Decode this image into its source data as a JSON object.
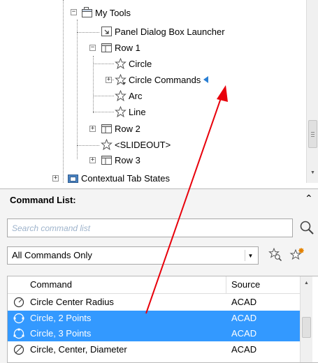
{
  "tree": {
    "nodes": [
      {
        "label": "My Tools"
      },
      {
        "label": "Panel Dialog Box Launcher"
      },
      {
        "label": "Row 1"
      },
      {
        "label": "Circle"
      },
      {
        "label": "Circle Commands"
      },
      {
        "label": "Arc"
      },
      {
        "label": "Line"
      },
      {
        "label": "Row 2"
      },
      {
        "label": "<SLIDEOUT>"
      },
      {
        "label": "Row 3"
      },
      {
        "label": "Contextual Tab States"
      }
    ],
    "expand_collapsed": "+",
    "expand_open": "−"
  },
  "command_panel": {
    "title": "Command List:",
    "collapse_glyph": "⌃",
    "search": {
      "placeholder": "Search command list",
      "value": ""
    },
    "filter": {
      "selected": "All Commands Only",
      "arrow": "▼"
    },
    "grid": {
      "columns": [
        "Command",
        "Source"
      ],
      "rows": [
        {
          "name": "Circle Center Radius",
          "source": "ACAD",
          "selected": false
        },
        {
          "name": "Circle, 2 Points",
          "source": "ACAD",
          "selected": true
        },
        {
          "name": "Circle, 3 Points",
          "source": "ACAD",
          "selected": true
        },
        {
          "name": "Circle, Center, Diameter",
          "source": "ACAD",
          "selected": false
        }
      ]
    }
  },
  "colors": {
    "selection": "#3399ff",
    "annotation_arrow": "#e8000b",
    "indicator_triangle": "#2a7fd4"
  }
}
